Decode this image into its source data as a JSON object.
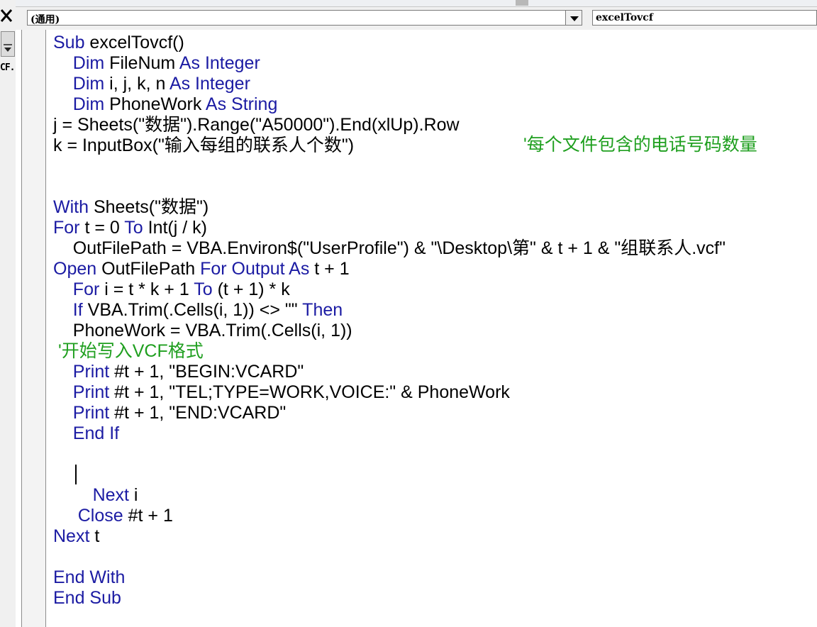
{
  "window": {
    "side_text": "CF.",
    "object_combo": "(通用)",
    "procedure_combo": "excelTovcf"
  },
  "code": {
    "lines": [
      [
        [
          "kw",
          "Sub"
        ],
        [
          "tx",
          " excelTovcf()"
        ]
      ],
      [
        [
          "tx",
          "    "
        ],
        [
          "kw",
          "Dim"
        ],
        [
          "tx",
          " FileNum "
        ],
        [
          "kw",
          "As Integer"
        ]
      ],
      [
        [
          "tx",
          "    "
        ],
        [
          "kw",
          "Dim"
        ],
        [
          "tx",
          " i, j, k, n "
        ],
        [
          "kw",
          "As Integer"
        ]
      ],
      [
        [
          "tx",
          "    "
        ],
        [
          "kw",
          "Dim"
        ],
        [
          "tx",
          " PhoneWork "
        ],
        [
          "kw",
          "As String"
        ]
      ],
      [
        [
          "tx",
          "j = Sheets(\"数据\").Range(\"A50000\").End(xlUp).Row"
        ]
      ],
      [
        [
          "tx",
          "k = InputBox(\"输入每组的联系人个数\")"
        ]
      ],
      [],
      [],
      [
        [
          "kw",
          "With"
        ],
        [
          "tx",
          " Sheets(\"数据\")"
        ]
      ],
      [
        [
          "kw",
          "For"
        ],
        [
          "tx",
          " t = 0 "
        ],
        [
          "kw",
          "To"
        ],
        [
          "tx",
          " Int(j / k)"
        ]
      ],
      [
        [
          "tx",
          "    OutFilePath = VBA.Environ$(\"UserProfile\") & \"\\Desktop\\第\" & t + 1 & \"组联系人.vcf\""
        ]
      ],
      [
        [
          "kw",
          "Open"
        ],
        [
          "tx",
          " OutFilePath "
        ],
        [
          "kw",
          "For Output As"
        ],
        [
          "tx",
          " t + 1"
        ]
      ],
      [
        [
          "tx",
          "    "
        ],
        [
          "kw",
          "For"
        ],
        [
          "tx",
          " i = t * k + 1 "
        ],
        [
          "kw",
          "To"
        ],
        [
          "tx",
          " (t + 1) * k"
        ]
      ],
      [
        [
          "tx",
          "    "
        ],
        [
          "kw",
          "If"
        ],
        [
          "tx",
          " VBA.Trim(.Cells(i, 1)) <> \"\" "
        ],
        [
          "kw",
          "Then"
        ]
      ],
      [
        [
          "tx",
          "    PhoneWork = VBA.Trim(.Cells(i, 1))"
        ]
      ],
      [
        [
          "cm",
          " '开始写入VCF格式"
        ]
      ],
      [
        [
          "tx",
          "    "
        ],
        [
          "kw",
          "Print"
        ],
        [
          "tx",
          " #t + 1, \"BEGIN:VCARD\""
        ]
      ],
      [
        [
          "tx",
          "    "
        ],
        [
          "kw",
          "Print"
        ],
        [
          "tx",
          " #t + 1, \"TEL;TYPE=WORK,VOICE:\" & PhoneWork"
        ]
      ],
      [
        [
          "tx",
          "    "
        ],
        [
          "kw",
          "Print"
        ],
        [
          "tx",
          " #t + 1, \"END:VCARD\""
        ]
      ],
      [
        [
          "tx",
          "    "
        ],
        [
          "kw",
          "End If"
        ]
      ],
      [],
      [],
      [
        [
          "tx",
          "        "
        ],
        [
          "kw",
          "Next"
        ],
        [
          "tx",
          " i"
        ]
      ],
      [
        [
          "tx",
          "     "
        ],
        [
          "kw",
          "Close"
        ],
        [
          "tx",
          " #t + 1"
        ]
      ],
      [
        [
          "kw",
          "Next"
        ],
        [
          "tx",
          " t"
        ]
      ],
      [],
      [
        [
          "kw",
          "End With"
        ]
      ],
      [
        [
          "kw",
          "End Sub"
        ]
      ]
    ],
    "inline_comment": "'每个文件包含的电话号码数量"
  },
  "colors": {
    "keyword": "#1b1ba3",
    "plain": "#000000",
    "comment": "#1f9f1f"
  }
}
